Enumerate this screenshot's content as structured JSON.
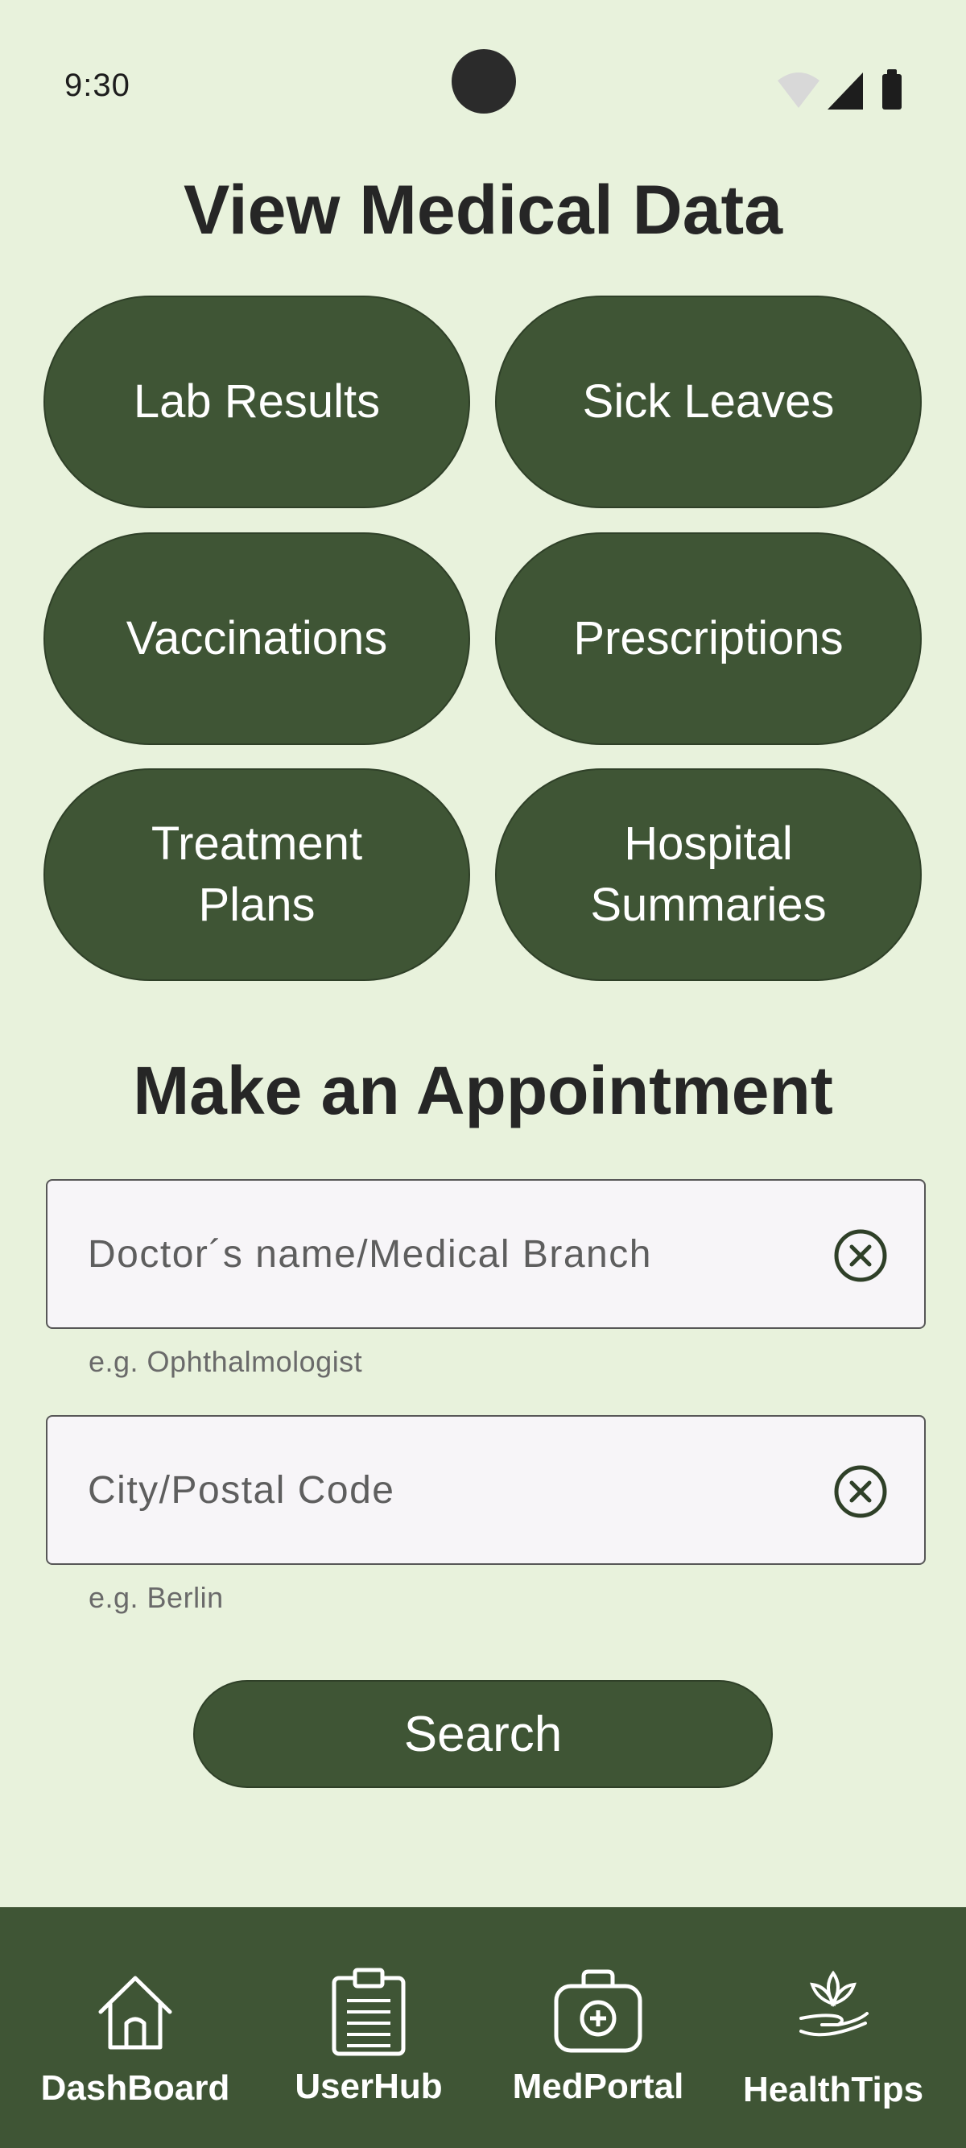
{
  "status_bar": {
    "time": "9:30",
    "icons": [
      "wifi-icon",
      "signal-icon",
      "battery-icon"
    ]
  },
  "medical_data": {
    "title": "View Medical Data",
    "buttons": [
      {
        "label": "Lab Results"
      },
      {
        "label": "Sick Leaves"
      },
      {
        "label": "Vaccinations"
      },
      {
        "label": "Prescriptions"
      },
      {
        "label": "Treatment Plans"
      },
      {
        "label": "Hospital Summaries"
      }
    ]
  },
  "appointment": {
    "title": "Make an Appointment",
    "doctor_field": {
      "placeholder": "Doctor´s name/Medical Branch",
      "value": "",
      "hint": "e.g. Ophthalmologist"
    },
    "city_field": {
      "placeholder": "City/Postal Code",
      "value": "",
      "hint": "e.g. Berlin"
    },
    "search_label": "Search"
  },
  "bottom_nav": {
    "items": [
      {
        "label": "DashBoard",
        "icon": "home-icon"
      },
      {
        "label": "UserHub",
        "icon": "clipboard-icon"
      },
      {
        "label": "MedPortal",
        "icon": "medical-kit-icon"
      },
      {
        "label": "HealthTips",
        "icon": "lotus-hand-icon"
      }
    ]
  },
  "colors": {
    "background": "#e8f2dc",
    "primary": "#3f5535",
    "text": "#262626",
    "field_bg": "#f7f5f8"
  }
}
